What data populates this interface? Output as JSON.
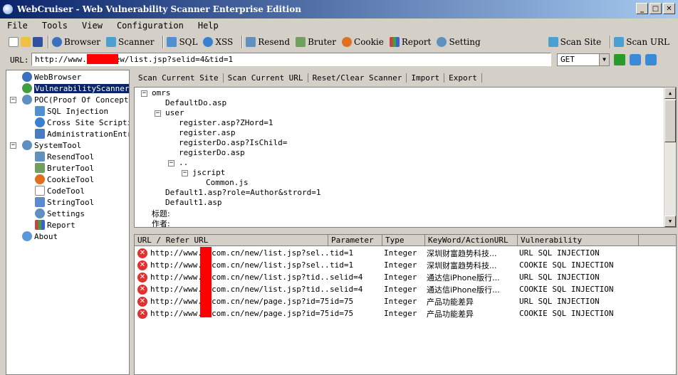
{
  "window": {
    "title": "WebCruiser - Web Vulnerability Scanner Enterprise Edition",
    "buttons": [
      "_",
      "□",
      "✕"
    ]
  },
  "menu": [
    "File",
    "Tools",
    "View",
    "Configuration",
    "Help"
  ],
  "toolbar": {
    "browser": "Browser",
    "scanner": "Scanner",
    "sql": "SQL",
    "xss": "XSS",
    "resend": "Resend",
    "bruter": "Bruter",
    "cookie": "Cookie",
    "report": "Report",
    "setting": "Setting",
    "scan_site": "Scan Site",
    "scan_url": "Scan URL"
  },
  "urlbar": {
    "label": "URL:",
    "value": "http://www.t      cn/new/list.jsp?selid=4&tid=1",
    "method": "GET"
  },
  "tree": {
    "webbrowser": "WebBrowser",
    "vulnscanner": "VulnerabilityScanner",
    "poc": "POC(Proof Of Concept)",
    "sqlinj": "SQL Injection",
    "xss": "Cross Site Scripting",
    "admin": "AdministrationEntrance",
    "systemtool": "SystemTool",
    "resendtool": "ResendTool",
    "brutertool": "BruterTool",
    "cookietool": "CookieTool",
    "codetool": "CodeTool",
    "stringtool": "StringTool",
    "settings": "Settings",
    "report": "Report",
    "about": "About"
  },
  "tabs": [
    "Scan Current Site",
    "Scan Current URL",
    "Reset/Clear Scanner",
    "Import",
    "Export"
  ],
  "domtree": {
    "root": "omrs",
    "n1": "DefaultDo.asp",
    "n2": "user",
    "n3": "register.asp?ZHord=1",
    "n4": "register.asp",
    "n5": "registerDo.asp?IsChild=",
    "n6": "registerDo.asp",
    "n7": "..",
    "n8": "jscript",
    "n9": "Common.js",
    "n10": "Default1.asp?role=Author&strord=1",
    "n11": "Default1.asp",
    "n12": "标题:",
    "n13": "作者:"
  },
  "vuln_table": {
    "columns": [
      "URL / Refer URL",
      "Parameter",
      "Type",
      "KeyWord/ActionURL",
      "Vulnerability"
    ],
    "rows": [
      {
        "url": "http://www.t     com.cn/new/list.jsp?sel...",
        "param": "tid=1",
        "type": "Integer",
        "keyword": "深圳财富趋势科技...",
        "vuln": "URL SQL INJECTION"
      },
      {
        "url": "http://www.t     com.cn/new/list.jsp?sel...",
        "param": "tid=1",
        "type": "Integer",
        "keyword": "深圳财富趋势科技...",
        "vuln": "COOKIE SQL INJECTION"
      },
      {
        "url": "http://www.t     com.cn/new/list.jsp?tid...",
        "param": "selid=4",
        "type": "Integer",
        "keyword": "通达信iPhone版行...",
        "vuln": "URL SQL INJECTION"
      },
      {
        "url": "http://www.t     com.cn/new/list.jsp?tid...",
        "param": "selid=4",
        "type": "Integer",
        "keyword": "通达信iPhone版行...",
        "vuln": "COOKIE SQL INJECTION"
      },
      {
        "url": "http://www.t     com.cn/new/page.jsp?id=75",
        "param": "id=75",
        "type": "Integer",
        "keyword": "产品功能差异",
        "vuln": "URL SQL INJECTION"
      },
      {
        "url": "http://www.t     com.cn/new/page.jsp?id=75",
        "param": "id=75",
        "type": "Integer",
        "keyword": "产品功能差异",
        "vuln": "COOKIE SQL INJECTION"
      }
    ]
  }
}
